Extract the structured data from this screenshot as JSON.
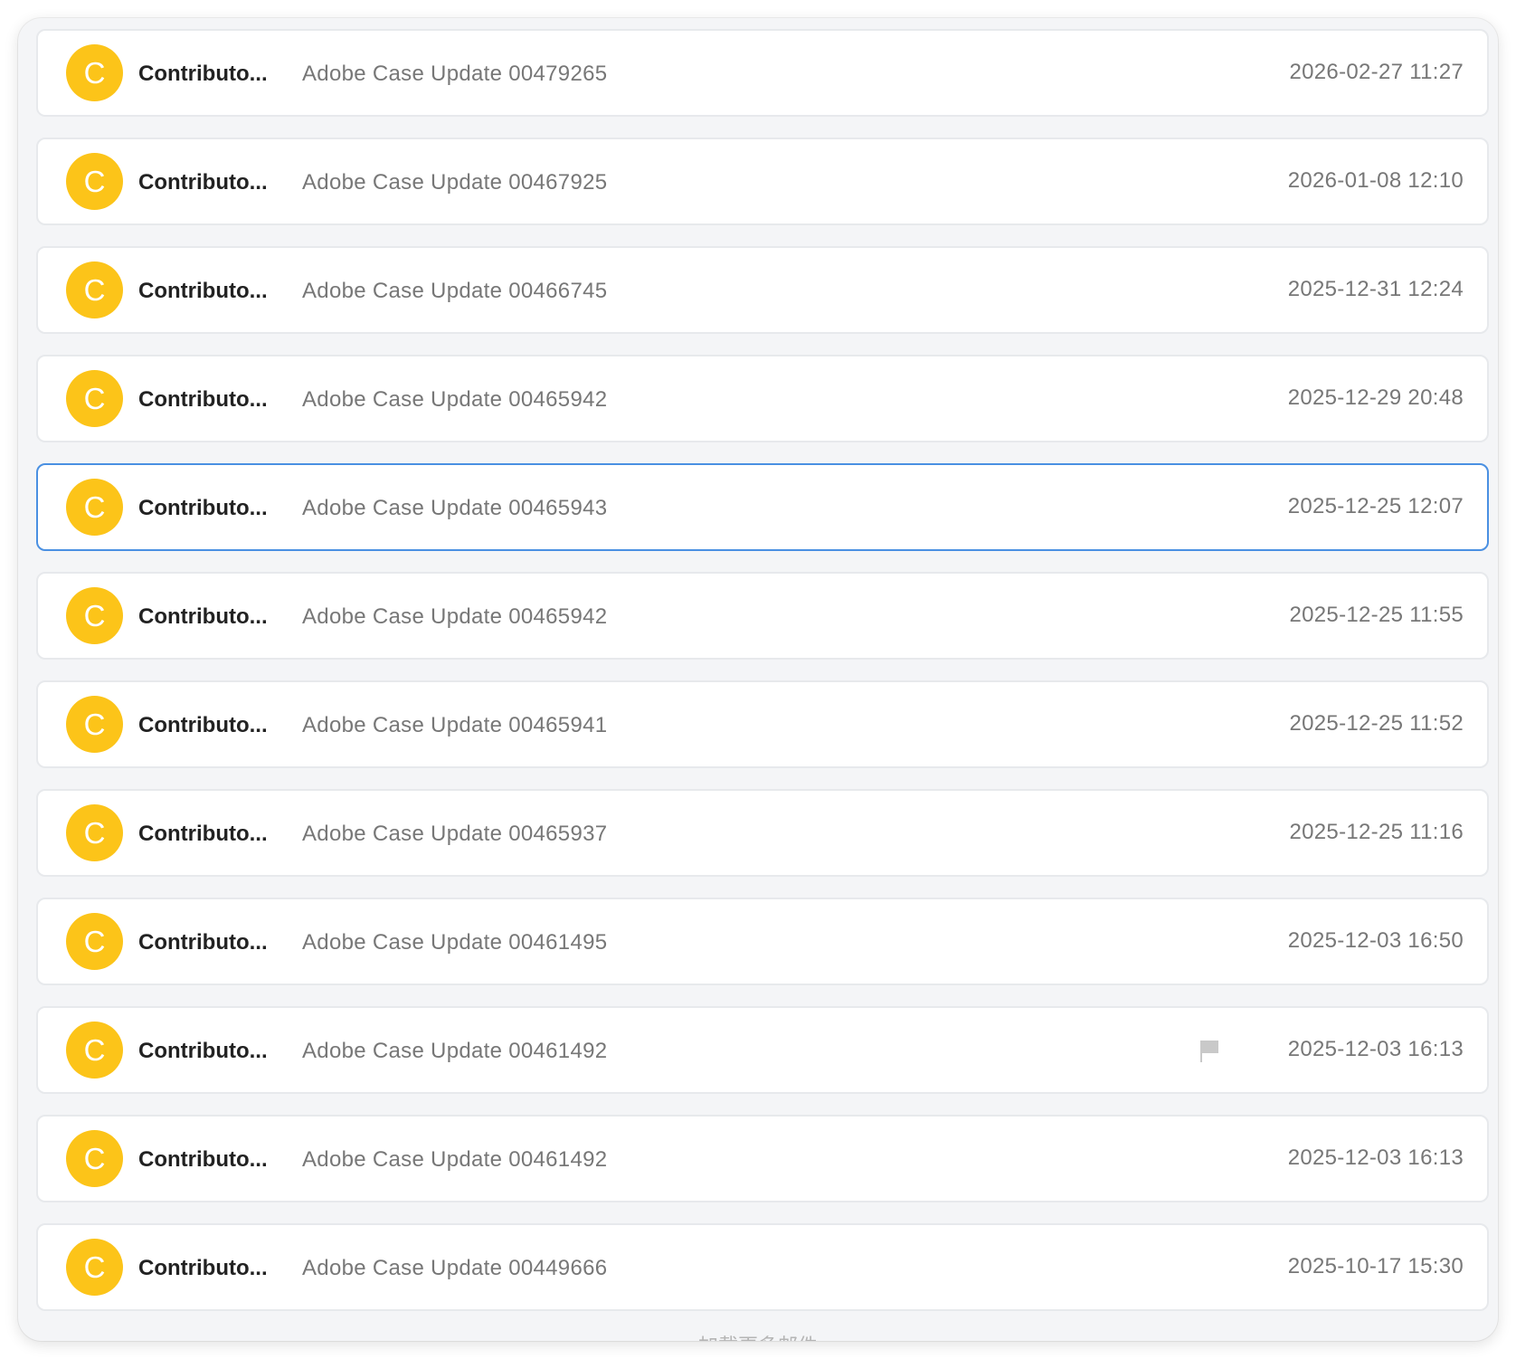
{
  "colors": {
    "avatar": "#fcc419",
    "selected_border": "#4a90e2"
  },
  "messages": [
    {
      "avatar": "C",
      "sender": "Contributo...",
      "subject": "Adobe Case Update 00479265",
      "date": "2026-02-27 11:27"
    },
    {
      "avatar": "C",
      "sender": "Contributo...",
      "subject": "Adobe Case Update 00467925",
      "date": "2026-01-08 12:10"
    },
    {
      "avatar": "C",
      "sender": "Contributo...",
      "subject": "Adobe Case Update 00466745",
      "date": "2025-12-31 12:24"
    },
    {
      "avatar": "C",
      "sender": "Contributo...",
      "subject": "Adobe Case Update 00465942",
      "date": "2025-12-29 20:48"
    },
    {
      "avatar": "C",
      "sender": "Contributo...",
      "subject": "Adobe Case Update 00465943",
      "date": "2025-12-25 12:07",
      "selected": true
    },
    {
      "avatar": "C",
      "sender": "Contributo...",
      "subject": "Adobe Case Update 00465942",
      "date": "2025-12-25 11:55"
    },
    {
      "avatar": "C",
      "sender": "Contributo...",
      "subject": "Adobe Case Update 00465941",
      "date": "2025-12-25 11:52"
    },
    {
      "avatar": "C",
      "sender": "Contributo...",
      "subject": "Adobe Case Update 00465937",
      "date": "2025-12-25 11:16"
    },
    {
      "avatar": "C",
      "sender": "Contributo...",
      "subject": "Adobe Case Update 00461495",
      "date": "2025-12-03 16:50"
    },
    {
      "avatar": "C",
      "sender": "Contributo...",
      "subject": "Adobe Case Update 00461492",
      "date": "2025-12-03 16:13",
      "flag_icon": "flag-icon"
    },
    {
      "avatar": "C",
      "sender": "Contributo...",
      "subject": "Adobe Case Update 00461492",
      "date": "2025-12-03 16:13"
    },
    {
      "avatar": "C",
      "sender": "Contributo...",
      "subject": "Adobe Case Update 00449666",
      "date": "2025-10-17 15:30"
    }
  ],
  "footer": {
    "load_more": "加载更多邮件"
  }
}
